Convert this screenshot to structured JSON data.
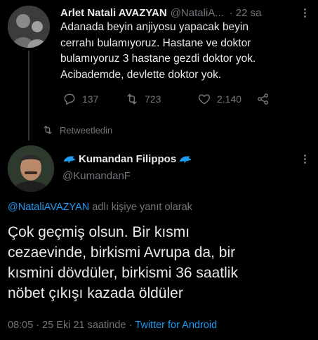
{
  "original_tweet": {
    "display_name": "Arlet Natali AVAZYAN",
    "handle": "@NataliA...",
    "separator": "·",
    "time": "22 sa",
    "text_lines": [
      "Adanada beyin anjiyosu yapacak beyin",
      "cerrahı bulamıyoruz. Hastane ve doktor",
      "bulamıyoruz 3 hastane gezdi doktor yok.",
      "Acibademde, devlette doktor yok."
    ],
    "actions": {
      "reply_count": "137",
      "retweet_count": "723",
      "like_count": "2.140"
    },
    "icons": {
      "reply": "reply-icon",
      "retweet": "retweet-icon",
      "like": "heart-icon",
      "share": "share-icon",
      "more": "more-icon"
    }
  },
  "retweet_notice": {
    "label": "Retweetledin",
    "icon": "retweet-icon"
  },
  "reply_tweet": {
    "display_name": "Kumandan Filippos",
    "handle": "@KumandanF",
    "name_emoji": "dolphin-icon",
    "replying_to_handle": "@NataliAVAZYAN",
    "replying_to_suffix": "adlı kişiye yanıt olarak",
    "text_lines": [
      "Çok geçmiş olsun. Bir kısmı",
      "cezaevinde, birkismi Avrupa da, bir",
      "kısmini dövdüler, birkismi 36 saatlik",
      "nöbet çıkışı kazada öldüler"
    ],
    "time": "08:05",
    "separator1": "·",
    "date": "25 Eki 21 saatinde",
    "separator2": "·",
    "source": "Twitter for Android"
  },
  "colors": {
    "background": "#000000",
    "text": "#e7e9ea",
    "muted": "#71767b",
    "link": "#1d9bf0",
    "dolphin": "#1d9bf0"
  }
}
